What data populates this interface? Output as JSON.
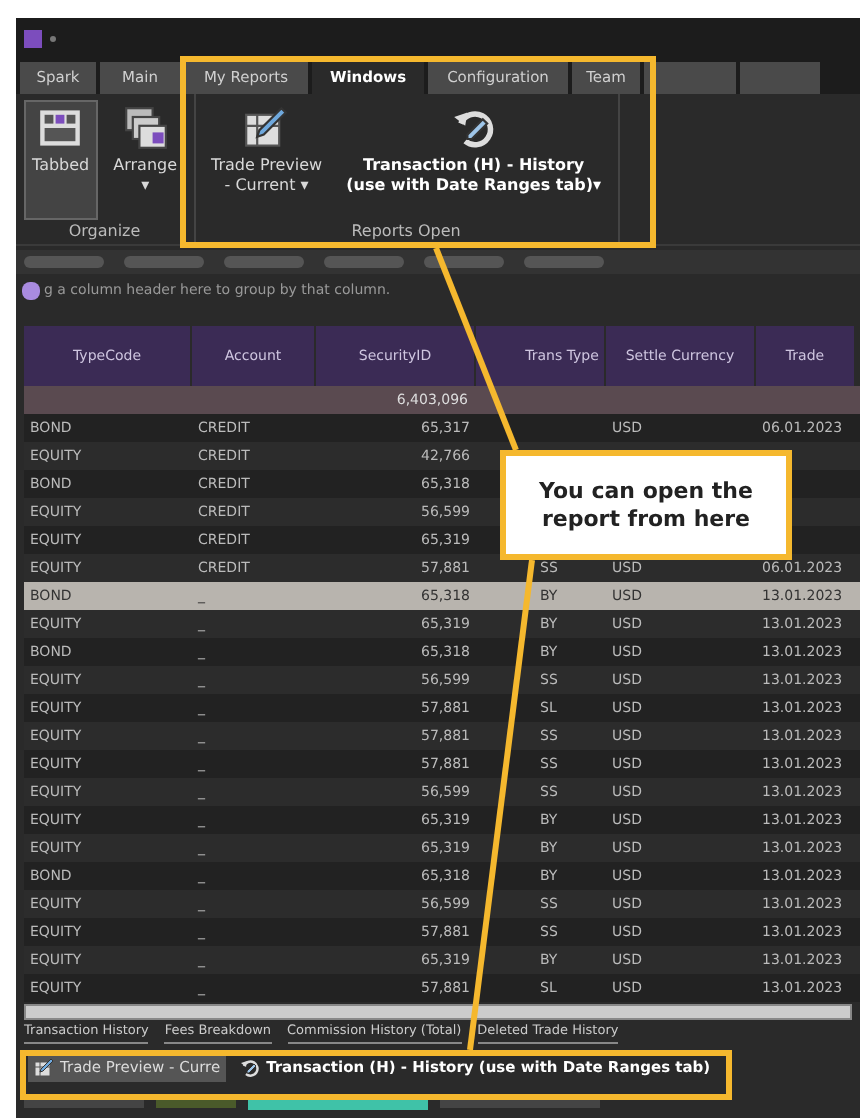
{
  "ribbon_tabs": [
    {
      "label": "Spark",
      "selected": false
    },
    {
      "label": "Main",
      "selected": false
    },
    {
      "label": "My Reports",
      "selected": false
    },
    {
      "label": "Windows",
      "selected": true
    },
    {
      "label": "Configuration",
      "selected": false
    },
    {
      "label": "Team",
      "selected": false
    }
  ],
  "ribbon_groups": [
    {
      "label": "Organize",
      "buttons": [
        {
          "label": "Tabbed",
          "selected": true,
          "bold": false
        },
        {
          "label": "Arrange",
          "sublabel": "▾",
          "selected": false,
          "bold": false
        }
      ]
    },
    {
      "label": "Reports Open",
      "buttons": [
        {
          "label": "Trade Preview",
          "sublabel": "- Current ▾",
          "selected": false,
          "bold": false
        },
        {
          "label": "Transaction (H) - History",
          "sublabel": "(use with Date Ranges tab)▾",
          "selected": false,
          "bold": true
        }
      ]
    }
  ],
  "group_hint": "g a column header here to group by that column.",
  "table": {
    "columns": [
      "TypeCode",
      "Account",
      "SecurityID",
      "Trans Type",
      "Settle Currency",
      "Trade"
    ],
    "summary": "6,403,096",
    "rows": [
      {
        "cells": [
          "BOND",
          "CREDIT",
          "65,317",
          "",
          "USD",
          "06.01.2023"
        ],
        "selected": false
      },
      {
        "cells": [
          "EQUITY",
          "CREDIT",
          "42,766",
          "",
          "",
          ""
        ],
        "selected": false
      },
      {
        "cells": [
          "BOND",
          "CREDIT",
          "65,318",
          "",
          "",
          ""
        ],
        "selected": false
      },
      {
        "cells": [
          "EQUITY",
          "CREDIT",
          "56,599",
          "",
          "",
          ""
        ],
        "selected": false
      },
      {
        "cells": [
          "EQUITY",
          "CREDIT",
          "65,319",
          "",
          "",
          ""
        ],
        "selected": false
      },
      {
        "cells": [
          "EQUITY",
          "CREDIT",
          "57,881",
          "SS",
          "USD",
          "06.01.2023"
        ],
        "selected": false
      },
      {
        "cells": [
          "BOND",
          "_",
          "65,318",
          "BY",
          "USD",
          "13.01.2023"
        ],
        "selected": true
      },
      {
        "cells": [
          "EQUITY",
          "_",
          "65,319",
          "BY",
          "USD",
          "13.01.2023"
        ],
        "selected": false
      },
      {
        "cells": [
          "BOND",
          "_",
          "65,318",
          "BY",
          "USD",
          "13.01.2023"
        ],
        "selected": false
      },
      {
        "cells": [
          "EQUITY",
          "_",
          "56,599",
          "SS",
          "USD",
          "13.01.2023"
        ],
        "selected": false
      },
      {
        "cells": [
          "EQUITY",
          "_",
          "57,881",
          "SL",
          "USD",
          "13.01.2023"
        ],
        "selected": false
      },
      {
        "cells": [
          "EQUITY",
          "_",
          "57,881",
          "SS",
          "USD",
          "13.01.2023"
        ],
        "selected": false
      },
      {
        "cells": [
          "EQUITY",
          "_",
          "57,881",
          "SS",
          "USD",
          "13.01.2023"
        ],
        "selected": false
      },
      {
        "cells": [
          "EQUITY",
          "_",
          "56,599",
          "SS",
          "USD",
          "13.01.2023"
        ],
        "selected": false
      },
      {
        "cells": [
          "EQUITY",
          "_",
          "65,319",
          "BY",
          "USD",
          "13.01.2023"
        ],
        "selected": false
      },
      {
        "cells": [
          "EQUITY",
          "_",
          "65,319",
          "BY",
          "USD",
          "13.01.2023"
        ],
        "selected": false
      },
      {
        "cells": [
          "BOND",
          "_",
          "65,318",
          "BY",
          "USD",
          "13.01.2023"
        ],
        "selected": false
      },
      {
        "cells": [
          "EQUITY",
          "_",
          "56,599",
          "SS",
          "USD",
          "13.01.2023"
        ],
        "selected": false
      },
      {
        "cells": [
          "EQUITY",
          "_",
          "57,881",
          "SS",
          "USD",
          "13.01.2023"
        ],
        "selected": false
      },
      {
        "cells": [
          "EQUITY",
          "_",
          "65,319",
          "BY",
          "USD",
          "13.01.2023"
        ],
        "selected": false
      },
      {
        "cells": [
          "EQUITY",
          "_",
          "57,881",
          "SL",
          "USD",
          "13.01.2023"
        ],
        "selected": false
      }
    ]
  },
  "sheet_tabs": [
    "Transaction History",
    "Fees Breakdown",
    "Commission History (Total)",
    "Deleted Trade History"
  ],
  "document_tabs": [
    {
      "label": "Trade Preview - Curre",
      "selected": true
    },
    {
      "label": "Transaction (H) - History (use with Date Ranges tab)",
      "selected": false
    }
  ],
  "callout": "You can open the report from here"
}
